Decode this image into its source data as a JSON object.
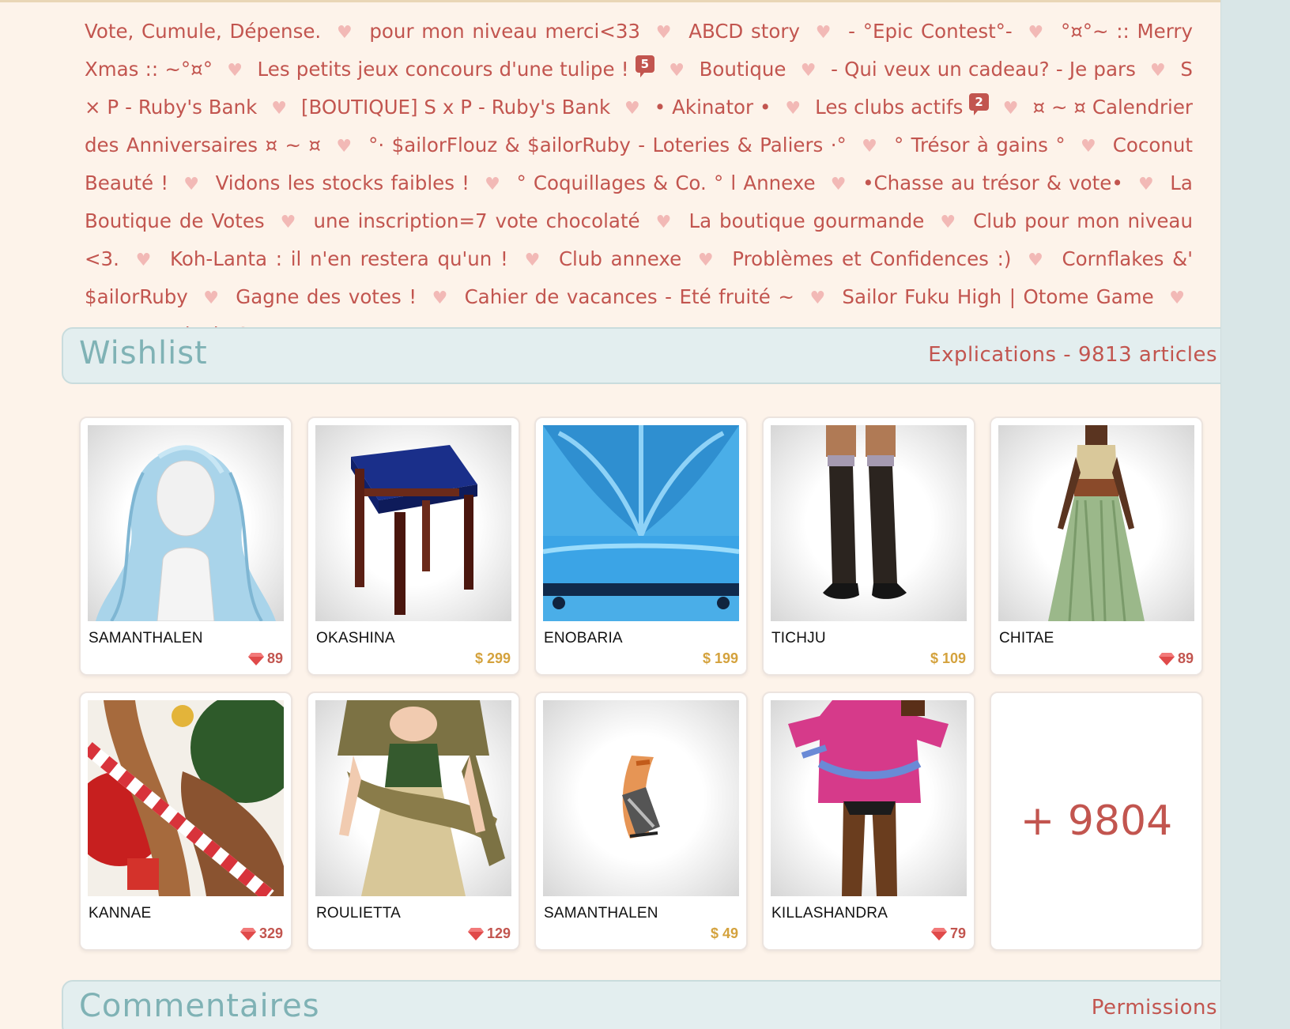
{
  "clubs": [
    {
      "label": "Vote, Cumule, Dépense."
    },
    {
      "label": "pour mon niveau merci<33"
    },
    {
      "label": "ABCD story"
    },
    {
      "label": "- °Epic Contest°-"
    },
    {
      "label": "°¤°~ :: Merry Xmas :: ~°¤°"
    },
    {
      "label": "Les petits jeux concours d'une tulipe !",
      "badge": "5"
    },
    {
      "label": "Boutique"
    },
    {
      "label": "- Qui veux un cadeau? - Je pars"
    },
    {
      "label": "S × P - Ruby's Bank"
    },
    {
      "label": "[BOUTIQUE] S x P - Ruby's Bank"
    },
    {
      "label": "• Akinator •"
    },
    {
      "label": "Les clubs actifs",
      "badge": "2"
    },
    {
      "label": "¤ ~ ¤ Calendrier des Anniversaires ¤ ~ ¤"
    },
    {
      "label": "°· $ailorFlouz & $ailorRuby - Loteries & Paliers ·°"
    },
    {
      "label": "° Trésor à gains °"
    },
    {
      "label": "Coconut Beauté !"
    },
    {
      "label": "Vidons les stocks faibles !"
    },
    {
      "label": "° Coquillages & Co. ° l Annexe"
    },
    {
      "label": "•Chasse au trésor & vote•"
    },
    {
      "label": "La Boutique de Votes"
    },
    {
      "label": "une inscription=7 vote chocolaté"
    },
    {
      "label": "La boutique gourmande"
    },
    {
      "label": "Club pour mon niveau <3."
    },
    {
      "label": "Koh-Lanta : il n'en restera qu'un !"
    },
    {
      "label": "Club annexe"
    },
    {
      "label": "Problèmes et Confidences :)"
    },
    {
      "label": "Cornflakes &' $ailorRuby"
    },
    {
      "label": "Gagne des votes !"
    },
    {
      "label": "Cahier de vacances - Eté fruité ~"
    },
    {
      "label": "Sailor Fuku High | Otome Game"
    },
    {
      "label": "Les Records de SF"
    }
  ],
  "wishlist": {
    "title": "Wishlist",
    "link": "Explications - 9813 articles",
    "items": [
      {
        "creator": "SAMANTHALEN",
        "price": "89",
        "currency": "ruby",
        "icon": "hair-item-icon"
      },
      {
        "creator": "OKASHINA",
        "price": "$ 299",
        "currency": "dollar",
        "icon": "table-item-icon"
      },
      {
        "creator": "ENOBARIA",
        "price": "$ 199",
        "currency": "dollar",
        "icon": "sofa-item-icon"
      },
      {
        "creator": "TICHJU",
        "price": "$ 109",
        "currency": "dollar",
        "icon": "boots-item-icon"
      },
      {
        "creator": "CHITAE",
        "price": "89",
        "currency": "ruby",
        "icon": "dress-item-icon"
      },
      {
        "creator": "KANNAE",
        "price": "329",
        "currency": "ruby",
        "icon": "christmas-item-icon"
      },
      {
        "creator": "ROULIETTA",
        "price": "129",
        "currency": "ruby",
        "icon": "gown-item-icon"
      },
      {
        "creator": "SAMANTHALEN",
        "price": "$ 49",
        "currency": "dollar",
        "icon": "skates-item-icon"
      },
      {
        "creator": "KILLASHANDRA",
        "price": "79",
        "currency": "ruby",
        "icon": "sweater-item-icon"
      }
    ],
    "more": "+ 9804"
  },
  "comments": {
    "title": "Commentaires",
    "link": "Permissions"
  },
  "colors": {
    "accent": "#c2554f",
    "header_text": "#7fb2b5",
    "gold": "#d4a23d",
    "background": "#fdf3ea"
  }
}
